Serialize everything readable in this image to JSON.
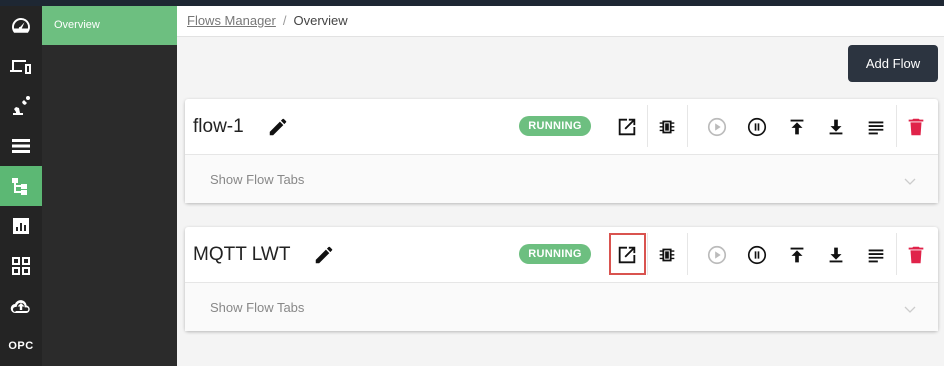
{
  "nav": {
    "icons": [
      "dashboard-icon",
      "devices-icon",
      "robot-arm-icon",
      "list-icon",
      "flows-icon",
      "chart-icon",
      "apps-grid-icon",
      "cloud-upload-icon"
    ],
    "opc_label": "OPC",
    "active_color": "#5cb874"
  },
  "subnav": {
    "overview_label": "Overview"
  },
  "breadcrumb": {
    "parent": "Flows Manager",
    "separator": "/",
    "current": "Overview"
  },
  "toolbar": {
    "add_flow_label": "Add Flow"
  },
  "flows": [
    {
      "name": "flow-1",
      "status": "RUNNING",
      "tabs_label": "Show Flow Tabs"
    },
    {
      "name": "MQTT LWT",
      "status": "RUNNING",
      "tabs_label": "Show Flow Tabs"
    }
  ],
  "colors": {
    "running": "#6dbf80",
    "delete": "#e0234a",
    "highlight": "#d9534f",
    "dark_button": "#2c3440"
  }
}
